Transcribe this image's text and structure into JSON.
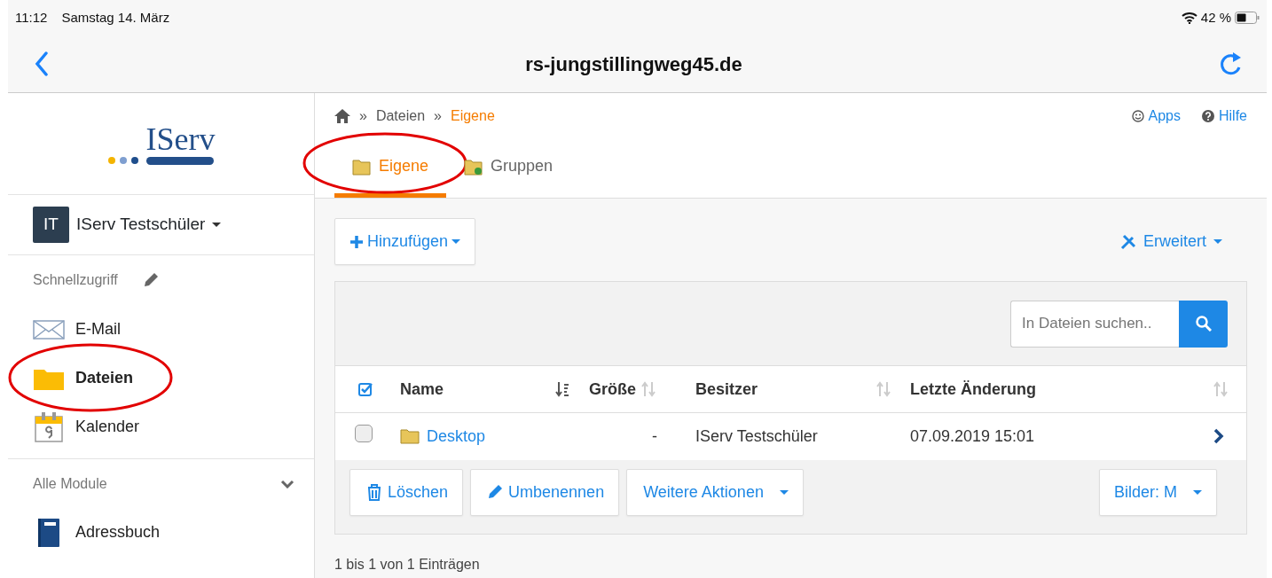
{
  "status_bar": {
    "time": "11:12",
    "date": "Samstag 14. März",
    "battery": "42 %"
  },
  "nav_bar": {
    "title": "rs-jungstillingweg45.de"
  },
  "sidebar": {
    "logo": "IServ",
    "user": {
      "initials": "IT",
      "name": "IServ Testschüler"
    },
    "quick_access": {
      "title": "Schnellzugriff",
      "items": [
        {
          "kind": "mail",
          "label": "E-Mail",
          "selected": false,
          "highlighted": false
        },
        {
          "kind": "folder",
          "label": "Dateien",
          "selected": true,
          "highlighted": true
        },
        {
          "kind": "calendar",
          "label": "Kalender",
          "selected": false,
          "highlighted": false
        }
      ]
    },
    "modules": {
      "title": "Alle Module",
      "items": [
        {
          "kind": "book",
          "label": "Adressbuch"
        }
      ]
    }
  },
  "breadcrumb": {
    "separator": "»",
    "items": [
      "Dateien",
      "Eigene"
    ]
  },
  "header_links": [
    {
      "kind": "apps",
      "label": "Apps"
    },
    {
      "kind": "help",
      "label": "Hilfe"
    }
  ],
  "tabs": [
    {
      "label": "Eigene",
      "selected": true,
      "highlighted": true
    },
    {
      "label": "Gruppen",
      "selected": false,
      "highlighted": false
    }
  ],
  "toolbar": {
    "add": "Hinzufügen",
    "advanced": "Erweitert"
  },
  "search": {
    "placeholder": "In Dateien suchen.."
  },
  "table": {
    "columns": [
      {
        "label": "Name",
        "sorted": true
      },
      {
        "label": "Größe",
        "sorted": false
      },
      {
        "label": "Besitzer",
        "sorted": false
      },
      {
        "label": "Letzte Änderung",
        "sorted": false
      }
    ],
    "rows": [
      {
        "checked": false,
        "name": "Desktop",
        "size": "-",
        "owner": "IServ Testschüler",
        "modified": "07.09.2019 15:01"
      }
    ]
  },
  "actions": [
    {
      "kind": "trash",
      "label": "Löschen"
    },
    {
      "kind": "pencil",
      "label": "Umbenennen"
    },
    {
      "kind": "dropdown",
      "label": "Weitere Aktionen"
    }
  ],
  "view_button": "Bilder: M",
  "info": "1 bis 1 von 1 Einträgen"
}
